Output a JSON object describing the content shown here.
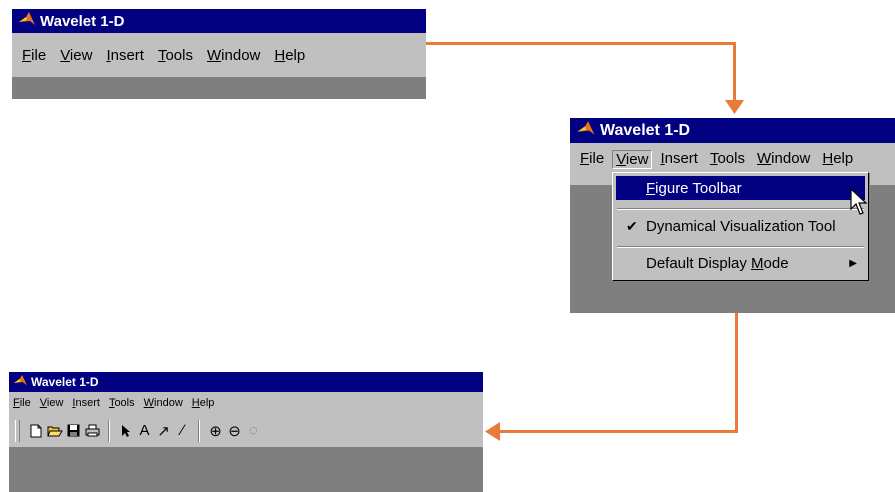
{
  "colors": {
    "titlebar": "#000080",
    "menu": "#c0c0c0",
    "client": "#7f7f7f",
    "arrow": "#e87a3a"
  },
  "window1": {
    "title": "Wavelet 1-D",
    "menu": [
      {
        "u": "F",
        "rest": "ile"
      },
      {
        "u": "V",
        "rest": "iew"
      },
      {
        "u": "I",
        "rest": "nsert"
      },
      {
        "u": "T",
        "rest": "ools"
      },
      {
        "u": "W",
        "rest": "indow"
      },
      {
        "u": "H",
        "rest": "elp"
      }
    ]
  },
  "window2": {
    "title": "Wavelet 1-D",
    "menu": [
      {
        "u": "F",
        "rest": "ile"
      },
      {
        "u": "V",
        "rest": "iew"
      },
      {
        "u": "I",
        "rest": "nsert"
      },
      {
        "u": "T",
        "rest": "ools"
      },
      {
        "u": "W",
        "rest": "indow"
      },
      {
        "u": "H",
        "rest": "elp"
      }
    ],
    "dropdown": {
      "item1_u": "F",
      "item1_rest": "igure Toolbar",
      "item2": "Dynamical Visualization Tool",
      "item2_check": "✔",
      "item3_pre": "Default Display ",
      "item3_u": "M",
      "item3_post": "ode",
      "item3_arrow": "▶"
    }
  },
  "window3": {
    "title": "Wavelet 1-D",
    "menu": [
      {
        "u": "F",
        "rest": "ile"
      },
      {
        "u": "V",
        "rest": "iew"
      },
      {
        "u": "I",
        "rest": "nsert"
      },
      {
        "u": "T",
        "rest": "ools"
      },
      {
        "u": "W",
        "rest": "indow"
      },
      {
        "u": "H",
        "rest": "elp"
      }
    ],
    "toolbar": {
      "new_icon": "new-file-icon",
      "open_icon": "open-folder-icon",
      "save_icon": "save-icon",
      "print_icon": "print-icon",
      "select_icon": "pointer-arrow-icon",
      "text_glyph": "A",
      "arrow_glyph": "↗",
      "line_glyph": "∕",
      "zoom_in_glyph": "⊕",
      "zoom_out_glyph": "⊖",
      "rotate_glyph": "◌"
    }
  }
}
